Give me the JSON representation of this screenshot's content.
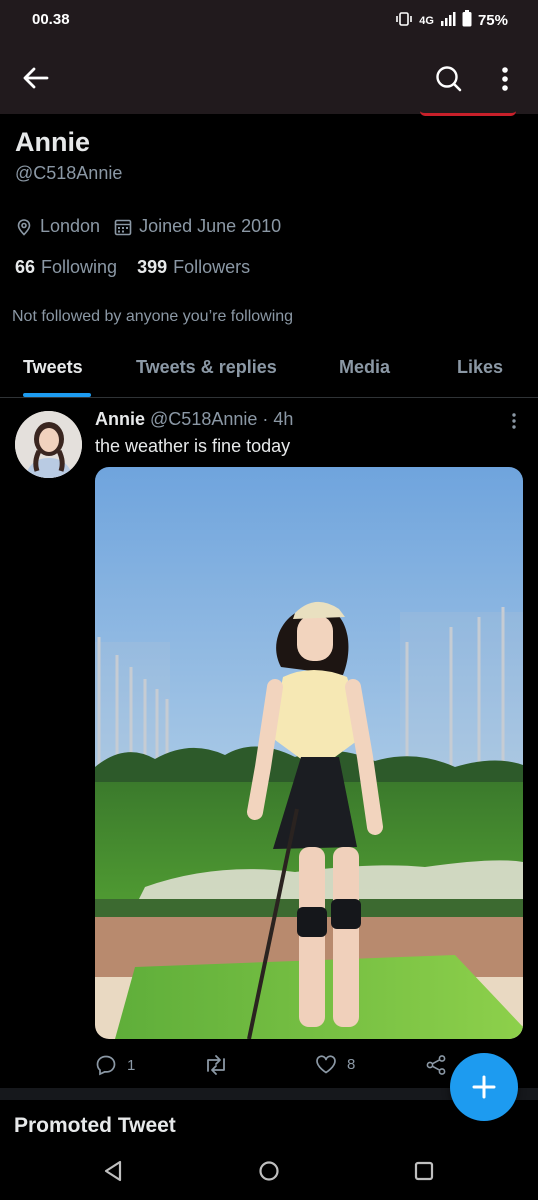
{
  "status_bar": {
    "time": "00.38",
    "network": "4G",
    "battery": "75%"
  },
  "profile": {
    "name": "Annie",
    "handle": "@C518Annie",
    "location": "London",
    "joined": "Joined June 2010",
    "following_count": "66",
    "following_label": "Following",
    "followers_count": "399",
    "followers_label": "Followers",
    "not_followed_text": "Not followed by anyone you’re following"
  },
  "tabs": [
    {
      "label": "Tweets",
      "active": true
    },
    {
      "label": "Tweets & replies",
      "active": false
    },
    {
      "label": "Media",
      "active": false
    },
    {
      "label": "Likes",
      "active": false
    }
  ],
  "tweet": {
    "author": "Annie",
    "handle": "@C518Annie",
    "separator": "·",
    "time": "4h",
    "text": "the weather is fine today",
    "reply_count": "1",
    "retweet_count": "",
    "like_count": "8"
  },
  "promoted_label": "Promoted Tweet",
  "icons": {
    "back": "arrow-left-icon",
    "search": "search-icon",
    "more": "more-vertical-icon",
    "location": "location-pin-icon",
    "calendar": "calendar-icon",
    "reply": "reply-icon",
    "retweet": "retweet-icon",
    "like": "heart-icon",
    "share": "share-icon",
    "compose": "plus-icon"
  },
  "colors": {
    "accent": "#1d9bf0",
    "background": "#000000",
    "header": "#211a1d",
    "secondary_text": "#8b98a5"
  }
}
